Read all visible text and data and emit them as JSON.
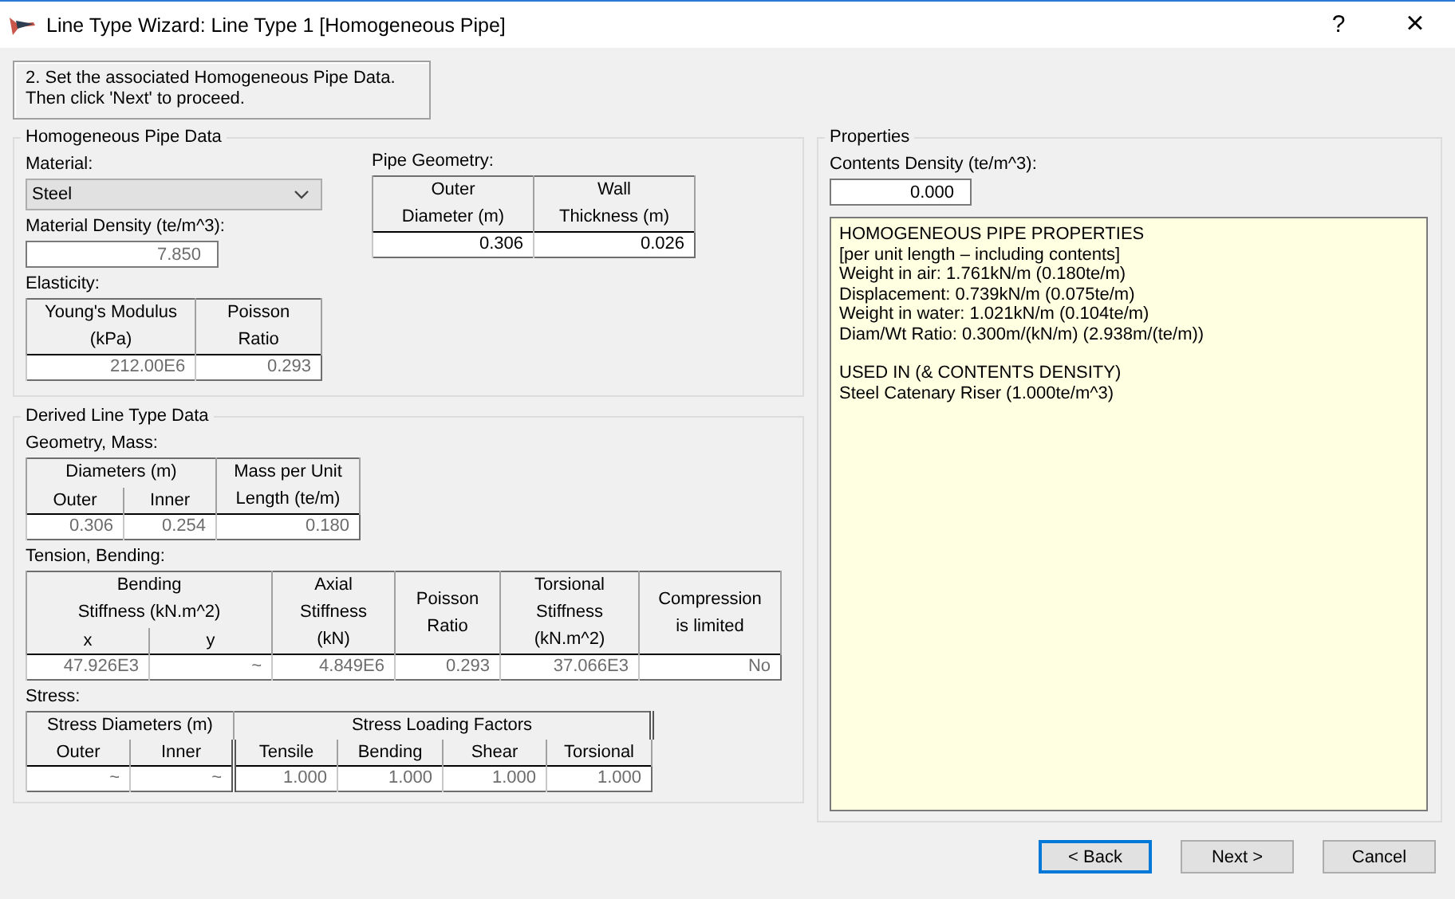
{
  "window": {
    "title": "Line Type Wizard: Line Type 1 [Homogeneous Pipe]",
    "help": "?",
    "close": "×"
  },
  "instruction": "2. Set the associated Homogeneous Pipe Data.\nThen click 'Next' to proceed.",
  "pipe_data": {
    "title": "Homogeneous Pipe Data",
    "material": {
      "label": "Material:",
      "value": "Steel"
    },
    "material_density": {
      "label": "Material Density (te/m^3):",
      "value": "7.850",
      "editable": false
    },
    "elasticity": {
      "label": "Elasticity:",
      "table": {
        "editable": false,
        "header_rows": [
          [
            {
              "text": "Young's Modulus\n(kPa)"
            },
            {
              "text": "Poisson\nRatio"
            }
          ]
        ],
        "values": [
          "212.00E6",
          "0.293"
        ]
      }
    },
    "pipe_geometry": {
      "label": "Pipe Geometry:",
      "table": {
        "editable": true,
        "header_rows": [
          [
            {
              "text": "Outer\nDiameter (m)"
            },
            {
              "text": "Wall\nThickness (m)"
            }
          ]
        ],
        "values": [
          "0.306",
          "0.026"
        ]
      }
    }
  },
  "derived": {
    "title": "Derived Line Type Data",
    "sections": [
      {
        "label": "Geometry, Mass:",
        "table": {
          "editable": false,
          "header_rows": [
            [
              {
                "text": "Diameters (m)",
                "colspan": 2
              },
              {
                "text": "Mass per Unit\nLength (te/m)",
                "rowspan": 2
              }
            ],
            [
              {
                "text": "Outer"
              },
              {
                "text": "Inner"
              }
            ]
          ],
          "values": [
            "0.306",
            "0.254",
            "0.180"
          ]
        }
      },
      {
        "label": "Tension, Bending:",
        "table": {
          "editable": false,
          "header_rows": [
            [
              {
                "text": "Bending\nStiffness (kN.m^2)",
                "colspan": 2
              },
              {
                "text": "Axial\nStiffness\n(kN)",
                "rowspan": 2
              },
              {
                "text": "Poisson\nRatio",
                "rowspan": 2
              },
              {
                "text": "Torsional\nStiffness\n(kN.m^2)",
                "rowspan": 2
              },
              {
                "text": "Compression\nis limited",
                "rowspan": 2
              }
            ],
            [
              {
                "text": "x"
              },
              {
                "text": "y"
              }
            ]
          ],
          "values": [
            "47.926E3",
            "~",
            "4.849E6",
            "0.293",
            "37.066E3",
            "No"
          ]
        }
      },
      {
        "label": "Stress:",
        "table": {
          "editable": false,
          "header_rows": [
            [
              {
                "text": "Stress Diameters (m)",
                "colspan": 2
              },
              {
                "text": "Stress Loading Factors",
                "colspan": 4
              }
            ],
            [
              {
                "text": "Outer"
              },
              {
                "text": "Inner"
              },
              {
                "text": "Tensile"
              },
              {
                "text": "Bending"
              },
              {
                "text": "Shear"
              },
              {
                "text": "Torsional"
              }
            ]
          ],
          "values": [
            "~",
            "~",
            "1.000",
            "1.000",
            "1.000",
            "1.000"
          ]
        }
      }
    ]
  },
  "properties": {
    "title": "Properties",
    "contents_density": {
      "label": "Contents Density (te/m^3):",
      "value": "0.000"
    },
    "text_blocks": [
      [
        "HOMOGENEOUS PIPE PROPERTIES",
        "[per unit length – including contents]",
        "Weight in air: 1.761kN/m (0.180te/m)",
        "Displacement: 0.739kN/m (0.075te/m)",
        "Weight in water: 1.021kN/m (0.104te/m)",
        "Diam/Wt Ratio: 0.300m/(kN/m) (2.938m/(te/m))"
      ],
      [
        "USED IN (& CONTENTS DENSITY)",
        "Steel Catenary Riser (1.000te/m^3)"
      ]
    ]
  },
  "buttons": [
    {
      "label": "< Back",
      "focused": true
    },
    {
      "label": "Next >",
      "focused": false
    },
    {
      "label": "Cancel",
      "focused": false
    }
  ]
}
